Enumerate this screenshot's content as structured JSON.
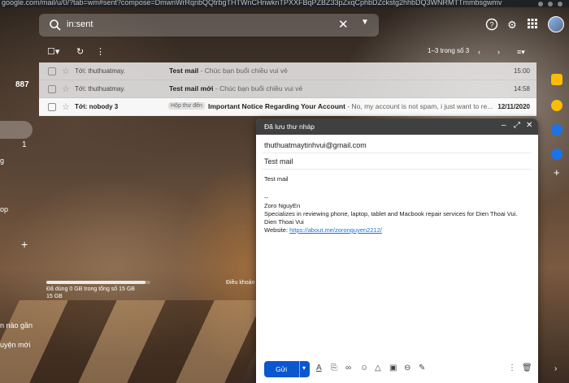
{
  "urlbar": {
    "url": "google.com/mail/u/0/?tab=wm#sent?compose=DmwnWrRqnbQQtrbgTHTWnCHnwknTPXXFBqPZBZ33pZxqCphbDZckstg2hhbDQ3WNRMTTmmbsgwmv"
  },
  "search": {
    "query": "in:sent",
    "clear_icon": "close-icon",
    "options_icon": "tune-icon"
  },
  "header_icons": [
    "help-icon",
    "settings-icon",
    "apps-icon"
  ],
  "left": {
    "inbox_count": "887",
    "unread_1": "1",
    "frag_a": "g",
    "frag_b": "op",
    "frag_c": "n nào gần",
    "frag_d": "uyện mới"
  },
  "toolbar": {
    "pager": "1–3 trong số 3"
  },
  "rows": [
    {
      "to": "Tới: thuthuatmay.",
      "label": "",
      "subject": "Test mail",
      "snippet": "- Chúc bạn buổi chiều vui vẻ",
      "date": "15:00",
      "unread": false
    },
    {
      "to": "Tới: thuthuatmay.",
      "label": "",
      "subject": "Test mail mới",
      "snippet": "- Chúc bạn buổi chiều vui vẻ",
      "date": "14:58",
      "unread": false
    },
    {
      "to": "Tới: nobody 3",
      "label": "Hộp thư đến",
      "subject": "Important Notice Regarding Your Account",
      "snippet": "- No, my account is not spam, i just want to re...",
      "date": "12/11/2020",
      "unread": true
    }
  ],
  "storage": {
    "used_fraction": 0.95,
    "text": "Đã dùng 0 GB trong tổng số 15 GB",
    "total": "15 GB",
    "policy": "Điều khoản"
  },
  "compose": {
    "title": "Đã lưu thư nháp",
    "to": "thuthuatmaytinhvui@gmail.com",
    "subject": "Test mail",
    "body_line1": "Test mail",
    "sig_sep": "--",
    "sig_name": "Zoro NguyEn",
    "sig_line2": "Specializes in reviewing phone, laptop, tablet and Macbook repair services for Dien Thoai Vui.",
    "sig_line3": "Dien Thoai Vui",
    "sig_web_label": "Website: ",
    "sig_link": "https://about.me/zoronguyen2212/",
    "send_label": "Gửi"
  },
  "colors": {
    "send": "#0b57d0",
    "compose_header": "#404040",
    "link": "#1a73e8"
  }
}
